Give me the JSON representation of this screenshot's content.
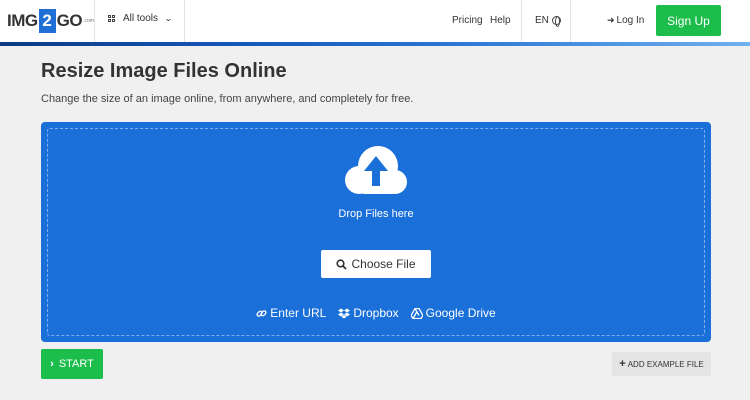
{
  "header": {
    "logo": {
      "left": "IMG",
      "mid": "2",
      "right": "GO",
      "suffix": ".com"
    },
    "all_tools_label": "All tools",
    "nav": {
      "pricing": "Pricing",
      "help": "Help"
    },
    "language": "EN",
    "login_label": "Log In",
    "signup_label": "Sign Up"
  },
  "main": {
    "title": "Resize Image Files Online",
    "subtitle": "Change the size of an image online, from anywhere, and completely for free."
  },
  "dropzone": {
    "drop_text": "Drop Files here",
    "choose_label": "Choose File",
    "sources": {
      "url": "Enter URL",
      "dropbox": "Dropbox",
      "gdrive": "Google Drive"
    }
  },
  "actions": {
    "start_label": "START",
    "example_label": "ADD EXAMPLE FILE"
  },
  "colors": {
    "brand_blue": "#1a6fd9",
    "accent_green": "#1dbd4c"
  }
}
